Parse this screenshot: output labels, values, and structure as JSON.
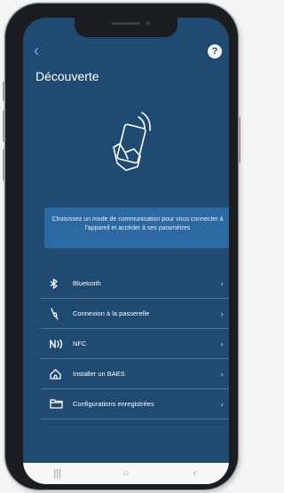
{
  "header": {
    "back_icon": "chevron-left-icon",
    "back_glyph": "‹",
    "help_glyph": "?",
    "title": "Découverte"
  },
  "info": {
    "text": "Choisissez un mode de communication pour vous connecter à l'appareil et accéder à ses paramètres"
  },
  "menu": {
    "items": [
      {
        "label": "Bluetooth",
        "icon": "bluetooth-icon"
      },
      {
        "label": "Connexion à la passerelle",
        "icon": "gateway-plug-icon"
      },
      {
        "label": "NFC",
        "icon": "nfc-icon"
      },
      {
        "label": "Installer un BAES",
        "icon": "house-icon"
      },
      {
        "label": "Configurations enregistrées",
        "icon": "folder-icon"
      }
    ],
    "chevron_glyph": "›"
  },
  "navbar": {
    "recents_glyph": "|||",
    "home_glyph": "○",
    "back_glyph": "‹"
  },
  "colors": {
    "background": "#1f4a72",
    "info_box": "#2d6aa3",
    "accent": "#6fb6ee",
    "divider": "#4f7396",
    "text": "#ffffff"
  }
}
